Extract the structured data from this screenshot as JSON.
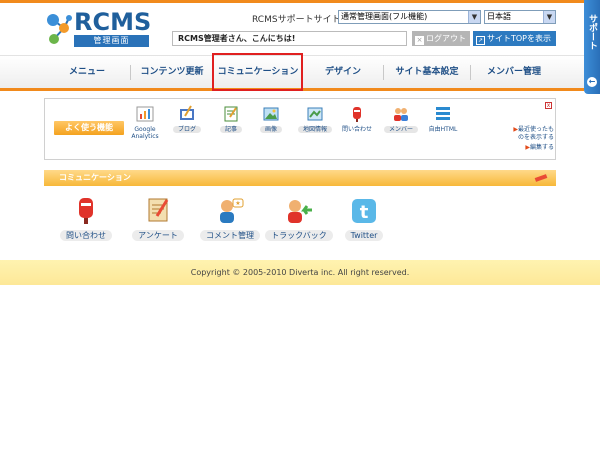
{
  "header": {
    "logo_text": "RCMS",
    "logo_sub": "管理画面",
    "support_site_label": "RCMSサポートサイト",
    "mode_select": "通常管理画面(フル機能)",
    "lang_select": "日本語",
    "greeting": "RCMS管理者さん、こんにちは!",
    "logout_label": "ログアウト",
    "site_top_label": "サイトTOPを表示"
  },
  "support_tab": {
    "label": "サポート",
    "arrow": "←"
  },
  "nav": {
    "items": [
      {
        "label": "メニュー"
      },
      {
        "label": "コンテンツ更新"
      },
      {
        "label": "コミュニケーション"
      },
      {
        "label": "デザイン"
      },
      {
        "label": "サイト基本設定"
      },
      {
        "label": "メンバー管理"
      }
    ],
    "active_index": 2
  },
  "favorites": {
    "label": "よく使う機能",
    "close": "x",
    "items": [
      {
        "label": "Google Analytics",
        "icon": "google-analytics-icon"
      },
      {
        "label": "ブログ",
        "icon": "blog-icon"
      },
      {
        "label": "記事",
        "icon": "article-icon"
      },
      {
        "label": "画像",
        "icon": "image-icon"
      },
      {
        "label": "地図情報",
        "icon": "map-icon"
      },
      {
        "label": "問い合わせ",
        "icon": "mailbox-icon"
      },
      {
        "label": "メンバー",
        "icon": "members-icon"
      },
      {
        "label": "自由HTML",
        "icon": "html-icon"
      }
    ],
    "link_recent": "最近使ったものを表示する",
    "link_edit": "編集する"
  },
  "communication": {
    "title": "コミュニケーション",
    "items": [
      {
        "label": "問い合わせ",
        "icon": "mailbox-icon"
      },
      {
        "label": "アンケート",
        "icon": "survey-icon"
      },
      {
        "label": "コメント管理",
        "icon": "comment-icon"
      },
      {
        "label": "トラックバック",
        "icon": "trackback-icon"
      },
      {
        "label": "Twitter",
        "icon": "twitter-icon"
      }
    ]
  },
  "footer": {
    "copyright": "Copyright © 2005-2010 Diverta inc. All right reserved."
  },
  "colors": {
    "accent": "#f18a1c",
    "nav_text": "#1f4f86",
    "highlight": "#e02020",
    "site_top_button": "#2d7ac0"
  }
}
